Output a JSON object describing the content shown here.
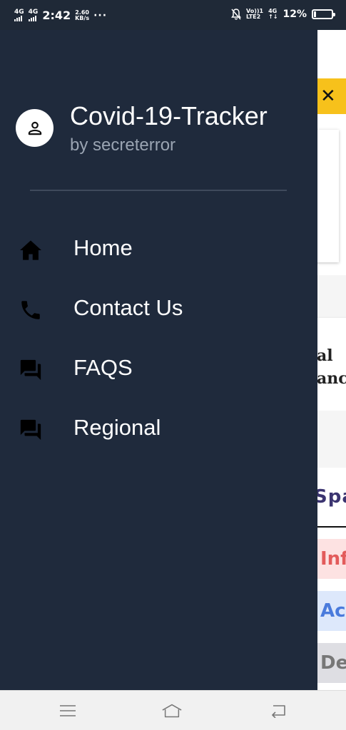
{
  "status_bar": {
    "sim1": "4G",
    "sim2": "4G",
    "time": "2:42",
    "speed_value": "2.60",
    "speed_unit": "KB/s",
    "overflow": "···",
    "volte_top": "Vo))1",
    "volte_bottom": "LTE2",
    "net_top": "4G",
    "net_bottom": "↑↓",
    "battery_percent": "12%",
    "battery_level": 0.12
  },
  "drawer": {
    "app_title": "Covid-19-Tracker",
    "app_subtitle": "by secreterror",
    "items": [
      {
        "label": "Home",
        "icon": "home-icon"
      },
      {
        "label": "Contact Us",
        "icon": "phone-icon"
      },
      {
        "label": "FAQS",
        "icon": "forum-icon"
      },
      {
        "label": "Regional",
        "icon": "forum-icon"
      }
    ]
  },
  "background": {
    "close_glyph": "✕",
    "card_text_1": "al",
    "card_text_2": "anc",
    "tab_text": "Spa",
    "stat_infected": "Inf",
    "stat_active": "Ac",
    "stat_deceased": "De"
  },
  "colors": {
    "drawer_bg": "#1f2a3c",
    "accent_yellow": "#f7c11b",
    "statusbar_bg": "#1f2937"
  }
}
